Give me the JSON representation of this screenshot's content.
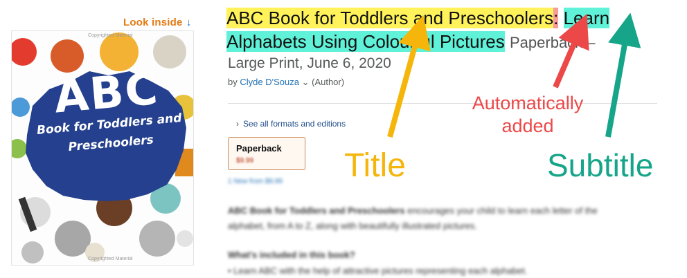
{
  "cover": {
    "look_inside": "Look inside",
    "look_inside_arrow": "↓",
    "abc": "ABC",
    "line1": "Book for Toddlers and",
    "line2": "Preschoolers",
    "watermark": "Copyrighted Material"
  },
  "product": {
    "title": "ABC Book for Toddlers and Preschoolers",
    "colon": ":",
    "subtitle_part1": "Learn",
    "subtitle_part2": "Alphabets Using Colourful Pictures",
    "format_trailing": "Paperback –",
    "edition": "Large Print, June 6, 2020",
    "by": "by",
    "author": "Clyde D'Souza",
    "author_caret": "⌄",
    "author_role": "(Author)",
    "see_all_formats": "See all formats and editions",
    "format_box": {
      "label": "Paperback",
      "price": "$9.99"
    },
    "new_from": "1 New from $9.99",
    "description": {
      "p1_bold": "ABC Book for Toddlers and Preschoolers",
      "p1_rest": "encourages your child to learn each letter of the alphabet, from A to Z, along with beautifully illustrated pictures.",
      "heading": "What's included in this book?",
      "bullet1": "• Learn ABC with the help of attractive pictures representing each alphabet."
    }
  },
  "annotations": {
    "title_label": "Title",
    "subtitle_label": "Subtitle",
    "auto_label": "Automatically added",
    "colors": {
      "title": "#f5b50b",
      "subtitle": "#17a58a",
      "auto": "#ec4848"
    }
  }
}
